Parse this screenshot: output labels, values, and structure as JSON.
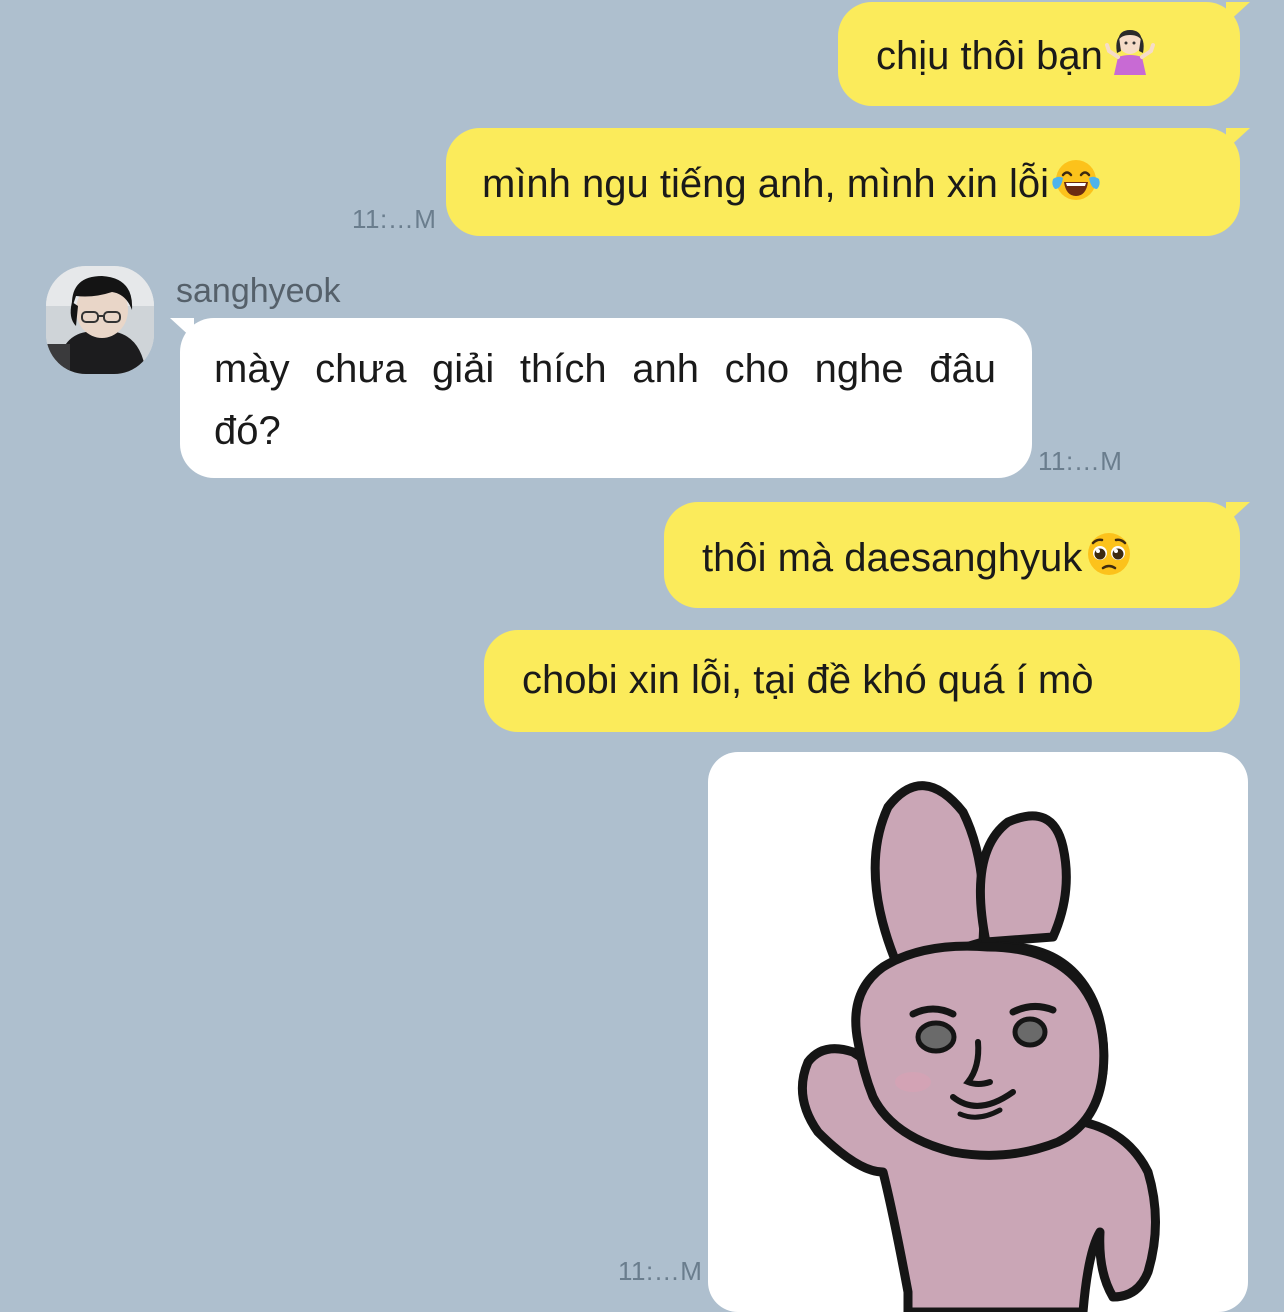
{
  "colors": {
    "background": "#aebfce",
    "outgoing_bubble": "#fbeb5b",
    "incoming_bubble": "#ffffff",
    "timestamp": "#6a7d8d"
  },
  "messages": [
    {
      "text": "chịu thôi bạn",
      "emoji": "person-shrugging-emoji"
    },
    {
      "text": "mình ngu tiếng anh, mình xin lỗi",
      "emoji": "tears-of-joy-emoji",
      "time": "11:…M"
    },
    {
      "sender": "sanghyeok",
      "text": "mày chưa giải thích anh cho nghe đâu đó?",
      "time": "11:…M"
    },
    {
      "text": "thôi mà daesanghyuk",
      "emoji": "pleading-face-emoji"
    },
    {
      "text": "chobi xin lỗi, tại đề khó quá í mò"
    },
    {
      "sticker": "pink-bunny-sticker",
      "time": "11:…M"
    }
  ]
}
